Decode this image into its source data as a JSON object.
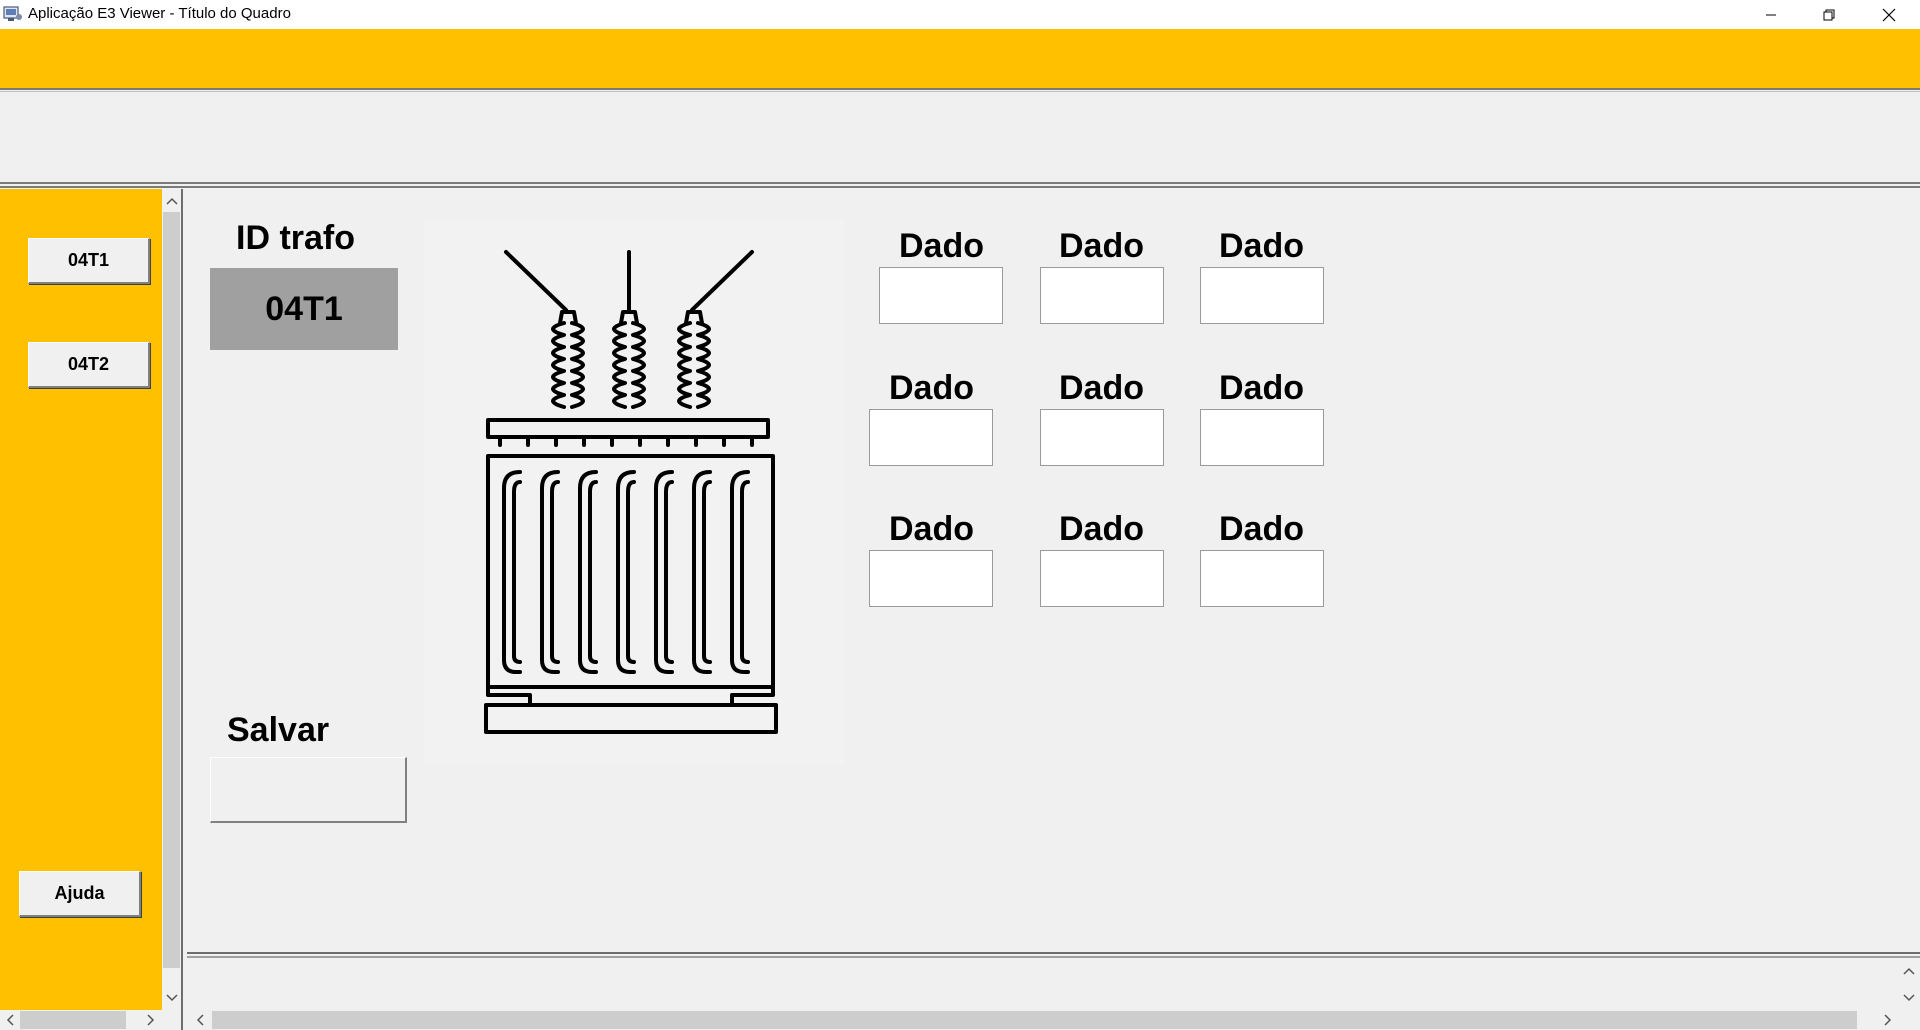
{
  "window": {
    "title": "Aplicação E3 Viewer - Título do Quadro",
    "minimize_glyph": "—",
    "restore_glyph": "❐",
    "close_glyph": "✕"
  },
  "colors": {
    "accent": "#ffc000",
    "background": "#f0f0f0",
    "id_display_bg": "#a0a0a0",
    "field_bg": "#ffffff"
  },
  "sidebar": {
    "buttons": [
      {
        "label": "04T1"
      },
      {
        "label": "04T2"
      }
    ],
    "help_label": "Ajuda"
  },
  "main": {
    "id_label": "ID trafo",
    "id_value": "04T1",
    "save_label": "Salvar",
    "save_value": "",
    "image_icon": "transformer-icon",
    "data_fields": [
      {
        "label": "Dado",
        "value": ""
      },
      {
        "label": "Dado",
        "value": ""
      },
      {
        "label": "Dado",
        "value": ""
      },
      {
        "label": "Dado",
        "value": ""
      },
      {
        "label": "Dado",
        "value": ""
      },
      {
        "label": "Dado",
        "value": ""
      },
      {
        "label": "Dado",
        "value": ""
      },
      {
        "label": "Dado",
        "value": ""
      },
      {
        "label": "Dado",
        "value": ""
      }
    ]
  },
  "scrollbars": {
    "up": "▲",
    "down": "▼",
    "left": "‹",
    "right": "›"
  }
}
